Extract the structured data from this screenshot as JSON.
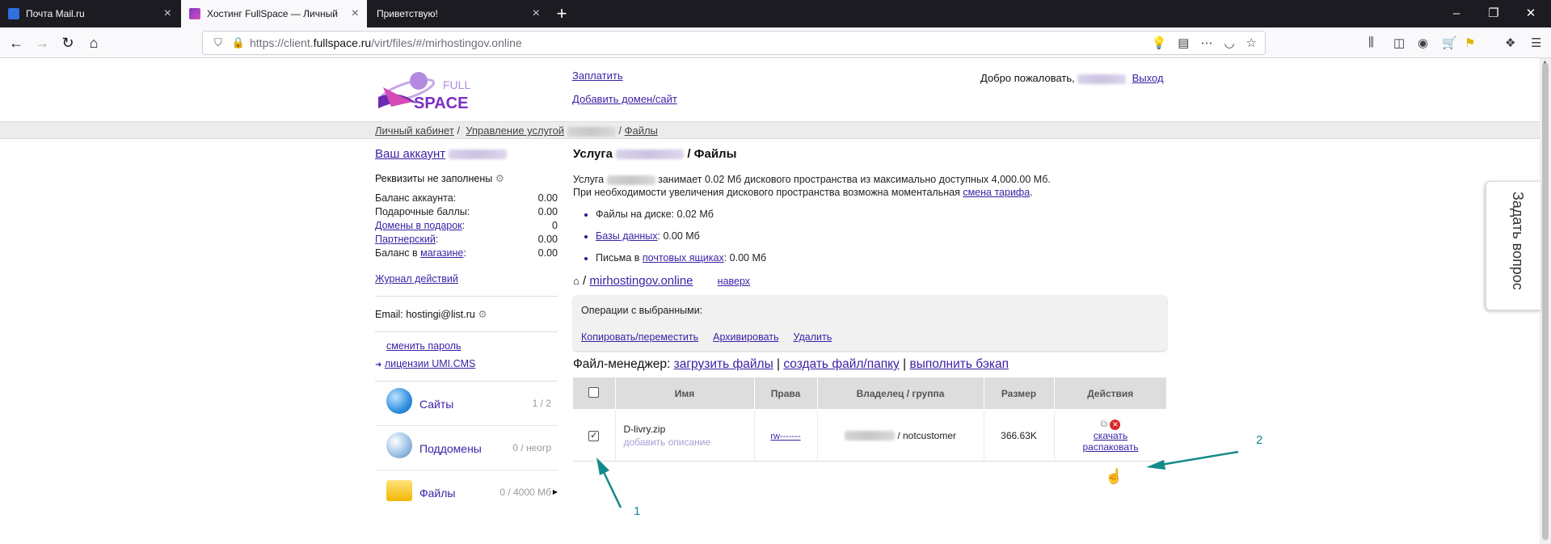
{
  "browser": {
    "tabs": [
      {
        "title": "Почта Mail.ru",
        "active": false
      },
      {
        "title": "Хостинг FullSpace — Личный",
        "active": true
      },
      {
        "title": "Приветствую!",
        "active": false
      }
    ],
    "url_prefix": "https://client.",
    "url_domain": "fullspace.ru",
    "url_suffix": "/virt/files/#/mirhostingov.online"
  },
  "header": {
    "logo_text_1": "FULL",
    "logo_text_2": "SPACE",
    "link_pay": "Заплатить",
    "link_add_domain": "Добавить домен/сайт",
    "welcome": "Добро пожаловать,",
    "logout": "Выход"
  },
  "breadcrumb": {
    "home": "Личный кабинет",
    "sep": "/",
    "services": "Управление услугой",
    "files": "Файлы"
  },
  "sidebar": {
    "account_label": "Ваш аккаунт",
    "requisites": "Реквизиты не заполнены",
    "balances": [
      {
        "label": "Баланс аккаунта:",
        "value": "0.00",
        "link": false
      },
      {
        "label": "Подарочные баллы:",
        "value": "0.00",
        "link": false
      },
      {
        "label": "Домены в подарок",
        "suffix": ":",
        "value": "0",
        "link": true
      },
      {
        "label": "Партнерский",
        "suffix": ":",
        "value": "0.00",
        "link": true
      },
      {
        "label_pre": "Баланс в ",
        "label": "магазине",
        "suffix": ":",
        "value": "0.00",
        "link": true
      }
    ],
    "journal": "Журнал действий",
    "email_label": "Email:",
    "email_value": "hostingi@list.ru",
    "change_password": "сменить пароль",
    "umi_licenses": "лицензии UMI.CMS",
    "services": [
      {
        "name": "Сайты",
        "count": "1 / 2"
      },
      {
        "name": "Поддомены",
        "count": "0 / неогр"
      },
      {
        "name": "Файлы",
        "count": "0 / 4000 Мб"
      }
    ]
  },
  "main": {
    "title_prefix": "Услуга",
    "title_suffix": "/ Файлы",
    "usage_prefix": "Услуга",
    "usage_text": "занимает 0.02 Мб дискового пространства из максимально доступных 4,000.00 Мб.",
    "expand_text": "При необходимости увеличения дискового пространства возможна моментальная",
    "change_tariff": "смена тарифа",
    "stats": [
      {
        "pre": "Файлы на диске: 0.02 Мб",
        "link": "",
        "post": ""
      },
      {
        "pre": "",
        "link": "Базы данных",
        "post": ": 0.00 Мб"
      },
      {
        "pre": "Письма в ",
        "link": "почтовых ящиках",
        "post": ": 0.00 Мб"
      }
    ],
    "path_sep": "/",
    "path_domain": "mirhostingov.online",
    "path_up": "наверх",
    "ops_title": "Операции с выбранными:",
    "ops": [
      "Копировать/переместить",
      "Архивировать",
      "Удалить"
    ],
    "fm_label": "Файл-менеджер:",
    "fm_links": [
      "загрузить файлы",
      "создать файл/папку",
      "выполнить бэкап"
    ],
    "fm_sep": "|",
    "table": {
      "headers": [
        "Имя",
        "Права",
        "Владелец / группа",
        "Размер",
        "Действия"
      ],
      "rows": [
        {
          "checked": true,
          "name": "D-livry.zip",
          "description": "добавить описание",
          "rights": "rw-------",
          "group": "/ notcustomer",
          "size": "366.63K",
          "action_download": "скачать",
          "action_unpack": "распаковать"
        }
      ]
    }
  },
  "ask_question": "Задать вопрос",
  "annotations": {
    "one": "1",
    "two": "2"
  },
  "colors": {
    "link": "#3b1fa6",
    "annotation": "#148a8a",
    "tabbar": "#1c1b22"
  }
}
